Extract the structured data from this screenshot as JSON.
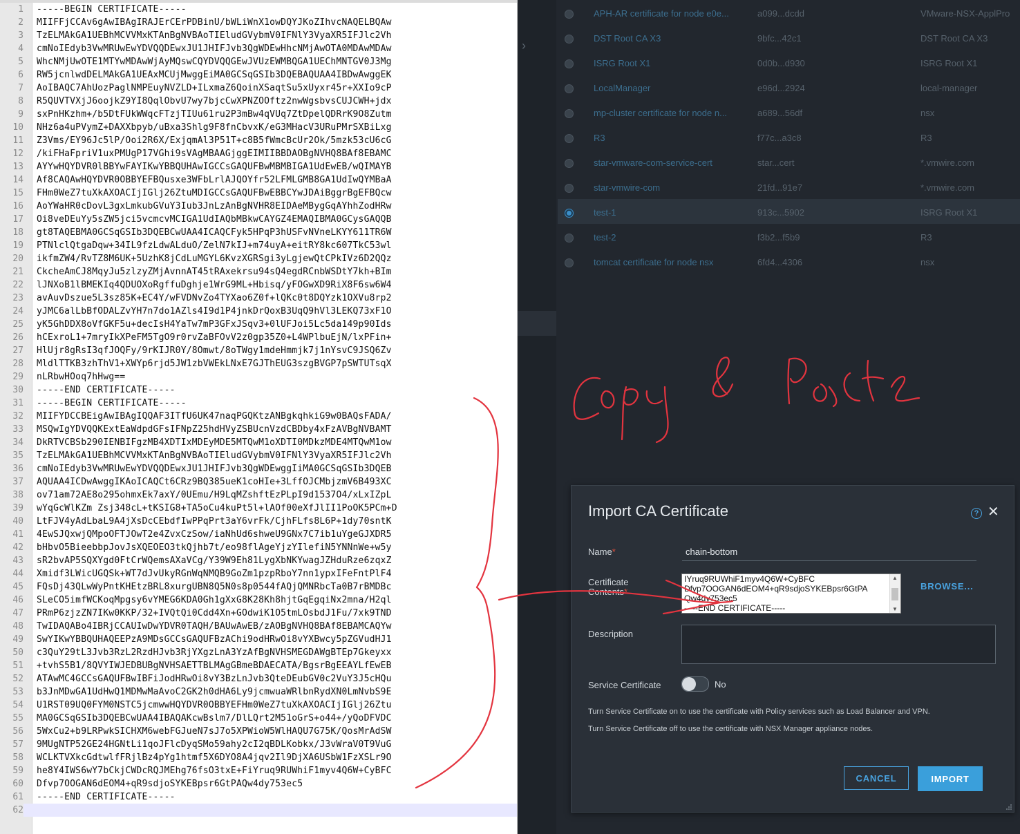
{
  "editor": {
    "lines": [
      {
        "n": "1",
        "t": "-----BEGIN CERTIFICATE-----"
      },
      {
        "n": "2",
        "t": "MIIFFjCCAv6gAwIBAgIRAJErCErPDBinU/bWLiWnX1owDQYJKoZIhvcNAQELBQAw"
      },
      {
        "n": "3",
        "t": "TzELMAkGA1UEBhMCVVMxKTAnBgNVBAoTIEludGVybmV0IFNlY3VyaXR5IFJlc2Vh"
      },
      {
        "n": "4",
        "t": "cmNoIEdyb3VwMRUwEwYDVQQDEwxJU1JHIFJvb3QgWDEwHhcNMjAwOTA0MDAwMDAw"
      },
      {
        "n": "5",
        "t": "WhcNMjUwOTE1MTYwMDAwWjAyMQswCQYDVQQGEwJVUzEWMBQGA1UEChMNTGV0J3Mg"
      },
      {
        "n": "6",
        "t": "RW5jcnlwdDELMAkGA1UEAxMCUjMwggEiMA0GCSqGSIb3DQEBAQUAA4IBDwAwggEK"
      },
      {
        "n": "7",
        "t": "AoIBAQC7AhUozPaglNMPEuyNVZLD+ILxmaZ6QoinXSaqtSu5xUyxr45r+XXIo9cP"
      },
      {
        "n": "8",
        "t": "R5QUVTVXjJ6oojkZ9YI8QqlObvU7wy7bjcCwXPNZOOftz2nwWgsbvsCUJCWH+jdx"
      },
      {
        "n": "9",
        "t": "sxPnHKzhm+/b5DtFUkWWqcFTzjTIUu61ru2P3mBw4qVUq7ZtDpelQDRrK9O8Zutm"
      },
      {
        "n": "10",
        "t": "NHz6a4uPVymZ+DAXXbpyb/uBxa3Shlg9F8fnCbvxK/eG3MHacV3URuPMrSXBiLxg"
      },
      {
        "n": "11",
        "t": "Z3Vms/EY96Jc5lP/Ooi2R6X/ExjqmAl3P51T+c8B5fWmcBcUr2Ok/5mzk53cU6cG"
      },
      {
        "n": "12",
        "t": "/kiFHaFpriV1uxPMUgP17VGhi9sVAgMBAAGjggEIMIIBBDAOBgNVHQ8BAf8EBAMC"
      },
      {
        "n": "13",
        "t": "AYYwHQYDVR0lBBYwFAYIKwYBBQUHAwIGCCsGAQUFBwMBMBIGA1UdEwEB/wQIMAYB"
      },
      {
        "n": "14",
        "t": "Af8CAQAwHQYDVR0OBBYEFBQusxe3WFbLrlAJQOYfr52LFMLGMB8GA1UdIwQYMBaA"
      },
      {
        "n": "15",
        "t": "FHm0WeZ7tuXkAXOACIjIGlj26ZtuMDIGCCsGAQUFBwEBBCYwJDAiBggrBgEFBQcw"
      },
      {
        "n": "16",
        "t": "AoYWaHR0cDovL3gxLmkubGVuY3Iub3JnLzAnBgNVHR8EIDAeMBygGqAYhhZodHRw"
      },
      {
        "n": "17",
        "t": "Oi8veDEuYy5sZW5jci5vcmcvMCIGA1UdIAQbMBkwCAYGZ4EMAQIBMA0GCysGAQQB"
      },
      {
        "n": "18",
        "t": "gt8TAQEBMA0GCSqGSIb3DQEBCwUAA4ICAQCFyk5HPqP3hUSFvNVneLKYY611TR6W"
      },
      {
        "n": "19",
        "t": "PTNlclQtgaDqw+34IL9fzLdwALduO/ZelN7kIJ+m74uyA+eitRY8kc607TkC53wl"
      },
      {
        "n": "20",
        "t": "ikfmZW4/RvTZ8M6UK+5UzhK8jCdLuMGYL6KvzXGRSgi3yLgjewQtCPkIVz6D2QQz"
      },
      {
        "n": "21",
        "t": "CkcheAmCJ8MqyJu5zlzyZMjAvnnAT45tRAxekrsu94sQ4egdRCnbWSDtY7kh+BIm"
      },
      {
        "n": "22",
        "t": "lJNXoB1lBMEKIq4QDUOXoRgffuDghje1WrG9ML+Hbisq/yFOGwXD9RiX8F6sw6W4"
      },
      {
        "n": "23",
        "t": "avAuvDszue5L3sz85K+EC4Y/wFVDNvZo4TYXao6Z0f+lQKc0t8DQYzk1OXVu8rp2"
      },
      {
        "n": "24",
        "t": "yJMC6alLbBfODALZvYH7n7do1AZls4I9d1P4jnkDrQoxB3UqQ9hVl3LEKQ73xF1O"
      },
      {
        "n": "25",
        "t": "yK5GhDDX8oVfGKF5u+decIsH4YaTw7mP3GFxJSqv3+0lUFJoi5Lc5da149p90Ids"
      },
      {
        "n": "26",
        "t": "hCExroL1+7mryIkXPeFM5TgO9r0rvZaBFOvV2z0gp35Z0+L4WPlbuEjN/lxPFin+"
      },
      {
        "n": "27",
        "t": "HlUjr8gRsI3qfJOQFy/9rKIJR0Y/8Omwt/8oTWgy1mdeHmmjk7j1nYsvC9JSQ6Zv"
      },
      {
        "n": "28",
        "t": "MldlTTKB3zhThV1+XWYp6rjd5JW1zbVWEkLNxE7GJThEUG3szgBVGP7pSWTUTsqX"
      },
      {
        "n": "29",
        "t": "nLRbwHOoq7hHwg=="
      },
      {
        "n": "30",
        "t": "-----END CERTIFICATE-----"
      },
      {
        "n": "31",
        "t": "-----BEGIN CERTIFICATE-----"
      },
      {
        "n": "32",
        "t": "MIIFYDCCBEigAwIBAgIQQAF3ITfU6UK47naqPGQKtzANBgkqhkiG9w0BAQsFADA/"
      },
      {
        "n": "33",
        "t": "MSQwIgYDVQQKExtEaWdpdGFsIFNpZ25hdHVyZSBUcnVzdCBDby4xFzAVBgNVBAMT"
      },
      {
        "n": "34",
        "t": "DkRTVCBSb290IENBIFgzMB4XDTIxMDEyMDE5MTQwM1oXDTI0MDkzMDE4MTQwM1ow"
      },
      {
        "n": "35",
        "t": "TzELMAkGA1UEBhMCVVMxKTAnBgNVBAoTIEludGVybmV0IFNlY3VyaXR5IFJlc2Vh"
      },
      {
        "n": "36",
        "t": "cmNoIEdyb3VwMRUwEwYDVQQDEwxJU1JHIFJvb3QgWDEwggIiMA0GCSqGSIb3DQEB"
      },
      {
        "n": "37",
        "t": "AQUAA4ICDwAwggIKAoICAQCt6CRz9BQ385ueK1coHIe+3LffOJCMbjzmV6B493XC"
      },
      {
        "n": "38",
        "t": "ov71am72AE8o295ohmxEk7axY/0UEmu/H9LqMZshftEzPLpI9d1537O4/xLxIZpL"
      },
      {
        "n": "39",
        "t": "wYqGcWlKZm Zsj348cL+tKSIG8+TA5oCu4kuPt5l+lAOf00eXfJlII1PoOK5PCm+D"
      },
      {
        "n": "40",
        "t": "LtFJV4yAdLbaL9A4jXsDcCEbdfIwPPqPrt3aY6vrFk/CjhFLfs8L6P+1dy70sntK"
      },
      {
        "n": "41",
        "t": "4EwSJQxwjQMpoOFTJOwT2e4ZvxCzSow/iaNhUd6shweU9GNx7C7ib1uYgeGJXDR5"
      },
      {
        "n": "42",
        "t": "bHbvO5BieebbpJovJsXQEOEO3tkQjhb7t/eo98flAgeYjzYIlefiN5YNNnWe+w5y"
      },
      {
        "n": "43",
        "t": "sR2bvAP5SQXYgd0FtCrWQemsAXaVCg/Y39W9Eh81LygXbNKYwagJZHduRze6zqxZ"
      },
      {
        "n": "44",
        "t": "Xmidf3LWicUGQSk+WT7dJvUkyRGnWqNMQB9GoZm1pzpRboY7nn1ypxIFeFntPlF4"
      },
      {
        "n": "45",
        "t": "FQsDj43QLwWyPntKHEtzBRL8xurgUBN8Q5N0s8p0544fAQjQMNRbcTa0B7rBMDBc"
      },
      {
        "n": "46",
        "t": "SLeCO5imfWCKoqMpgsy6vYMEG6KDA0Gh1gXxG8K28Kh8hjtGqEgqiNx2mna/H2ql"
      },
      {
        "n": "47",
        "t": "PRmP6zjzZN7IKw0KKP/32+IVQtQi0Cdd4Xn+GOdwiK1O5tmLOsbdJ1Fu/7xk9TND"
      },
      {
        "n": "48",
        "t": "TwIDAQABo4IBRjCCAUIwDwYDVR0TAQH/BAUwAwEB/zAOBgNVHQ8BAf8EBAMCAQYw"
      },
      {
        "n": "49",
        "t": "SwYIKwYBBQUHAQEEPzA9MDsGCCsGAQUFBzAChi9odHRwOi8vYXBwcy5pZGVudHJ1"
      },
      {
        "n": "50",
        "t": "c3QuY29tL3Jvb3RzL2RzdHJvb3RjYXgzLnA3YzAfBgNVHSMEGDAWgBTEp7Gkeyxx"
      },
      {
        "n": "51",
        "t": "+tvhS5B1/8QVYIWJEDBUBgNVHSAETTBLMAgGBmeBDAECATA/BgsrBgEEAYLfEwEB"
      },
      {
        "n": "52",
        "t": "ATAwMC4GCCsGAQUFBwIBFiJodHRwOi8vY3BzLnJvb3QteDEubGV0c2VuY3J5cHQu"
      },
      {
        "n": "53",
        "t": "b3JnMDwGA1UdHwQ1MDMwMaAvoC2GK2h0dHA6Ly9jcmwuaWRlbnRydXN0LmNvbS9E"
      },
      {
        "n": "54",
        "t": "U1RST09UQ0FYM0NSTC5jcmwwHQYDVR0OBBYEFHm0WeZ7tuXkAXOACIjIGlj26Ztu"
      },
      {
        "n": "55",
        "t": "MA0GCSqGSIb3DQEBCwUAA4IBAQAKcwBslm7/DlLQrt2M51oGrS+o44+/yQoDFVDC"
      },
      {
        "n": "56",
        "t": "5WxCu2+b9LRPwkSICHXM6webFGJueN7sJ7o5XPWioW5WlHAQU7G75K/QosMrAdSW"
      },
      {
        "n": "57",
        "t": "9MUgNTP52GE24HGNtLi1qoJFlcDyqSMo59ahy2cI2qBDLKobkx/J3vWraV0T9VuG"
      },
      {
        "n": "58",
        "t": "WCLKTVXkcGdtwlfFRjlBz4pYg1htmf5X6DYO8A4jqv2Il9DjXA6USbW1FzXSLr9O"
      },
      {
        "n": "59",
        "t": "he8Y4IWS6wY7bCkjCWDcRQJMEhg76fsO3txE+FiYruq9RUWhiF1myv4Q6W+CyBFC"
      },
      {
        "n": "60",
        "t": "Dfvp7OOGAN6dEOM4+qR9sdjoSYKEBpsr6GtPAQw4dy753ec5"
      },
      {
        "n": "61",
        "t": "-----END CERTIFICATE-----"
      },
      {
        "n": "62",
        "t": ""
      }
    ]
  },
  "table": {
    "rows": [
      {
        "name": "APH-AR certificate for node e0e...",
        "id": "a099...dcdd",
        "issuer": "VMware-NSX-ApplPro"
      },
      {
        "name": "DST Root CA X3",
        "id": "9bfc...42c1",
        "issuer": "DST Root CA X3"
      },
      {
        "name": "ISRG Root X1",
        "id": "0d0b...d930",
        "issuer": "ISRG Root X1"
      },
      {
        "name": "LocalManager",
        "id": "e96d...2924",
        "issuer": "local-manager"
      },
      {
        "name": "mp-cluster certificate for node n...",
        "id": "a689...56df",
        "issuer": "nsx"
      },
      {
        "name": "R3",
        "id": "f77c...a3c8",
        "issuer": "R3"
      },
      {
        "name": "star-vmware-com-service-cert",
        "id": "star...cert",
        "issuer": "*.vmwire.com"
      },
      {
        "name": "star-vmwire-com",
        "id": "21fd...91e7",
        "issuer": "*.vmwire.com"
      },
      {
        "name": "test-1",
        "id": "913c...5902",
        "issuer": "ISRG Root X1"
      },
      {
        "name": "test-2",
        "id": "f3b2...f5b9",
        "issuer": "R3"
      },
      {
        "name": "tomcat certificate for node nsx",
        "id": "6fd4...4306",
        "issuer": "nsx"
      }
    ]
  },
  "dialog": {
    "title": "Import CA Certificate",
    "help_icon_glyph": "?",
    "close_icon_glyph": "✕",
    "name_label": "Name",
    "name_value": "chain-bottom",
    "required_mark": "*",
    "cert_label_line1": "Certificate",
    "cert_label_line2": "Contents",
    "cert_content_lines": [
      "IYruq9RUWhiF1myv4Q6W+CyBFC",
      "Dfvp7OOGAN6dEOM4+qR9sdjoSYKEBpsr6GtPA",
      "Qw4dy753ec5",
      "-----END CERTIFICATE-----"
    ],
    "browse_label": "BROWSE...",
    "description_label": "Description",
    "service_cert_label": "Service Certificate",
    "service_cert_value": "No",
    "note_on": "Turn Service Certificate on to use the certificate with Policy services such as Load Balancer and VPN.",
    "note_off": "Turn Service Certificate off to use the certificate with NSX Manager appliance nodes.",
    "cancel_label": "CANCEL",
    "import_label": "IMPORT"
  },
  "annotation": {
    "ink_color": "#e3343f",
    "handwritten_text": "Copy & Paste"
  },
  "colors": {
    "accent": "#49a3e0",
    "panel_bg": "#22272e",
    "dialog_bg": "#2a3038"
  }
}
